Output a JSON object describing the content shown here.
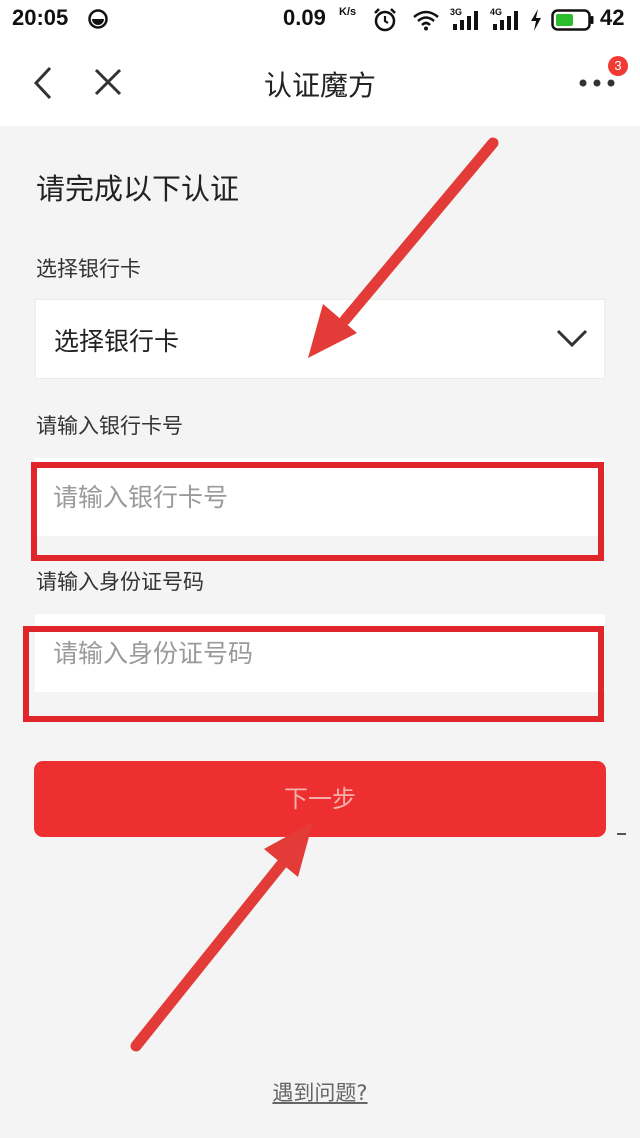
{
  "status_bar": {
    "time": "20:05",
    "network_speed": "0.09",
    "network_speed_unit": "K/s",
    "battery_level": "42",
    "icons": [
      "app-notification-icon",
      "alarm-icon",
      "wifi-icon",
      "signal-3g-icon",
      "signal-4g-icon",
      "charging-icon",
      "battery-icon"
    ]
  },
  "nav": {
    "title": "认证魔方",
    "more_badge_count": "3",
    "icons": [
      "back-chevron-icon",
      "close-icon",
      "more-dots-icon"
    ]
  },
  "form": {
    "heading": "请完成以下认证",
    "bank_card_select": {
      "label": "选择银行卡",
      "value": "选择银行卡"
    },
    "card_number": {
      "label": "请输入银行卡号",
      "placeholder": "请输入银行卡号",
      "value": ""
    },
    "id_number": {
      "label": "请输入身份证号码",
      "placeholder": "请输入身份证号码",
      "value": ""
    },
    "next_button_label": "下一步"
  },
  "footer": {
    "help_link": "遇到问题?"
  },
  "colors": {
    "accent": "#ee2f2f",
    "annotation": "#e0262a",
    "page_background": "#f4f4f4",
    "header_background": "#ffffff"
  }
}
